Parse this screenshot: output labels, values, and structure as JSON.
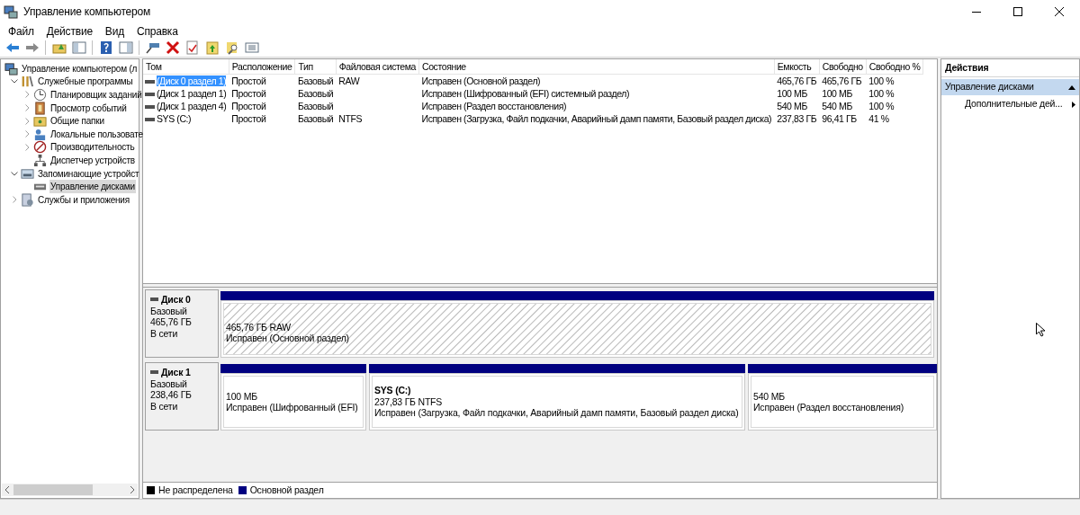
{
  "window": {
    "title": "Управление компьютером"
  },
  "menu": [
    "Файл",
    "Действие",
    "Вид",
    "Справка"
  ],
  "tree": [
    {
      "label": "Управление компьютером (л",
      "selected": false,
      "children": [
        {
          "label": "Служебные программы",
          "selected": false,
          "expanded": true,
          "children": [
            {
              "label": "Планировщик заданий",
              "selected": false,
              "expanded": false
            },
            {
              "label": "Просмотр событий",
              "selected": false,
              "expanded": false
            },
            {
              "label": "Общие папки",
              "selected": false,
              "expanded": false
            },
            {
              "label": "Локальные пользовате",
              "selected": false,
              "expanded": false
            },
            {
              "label": "Производительность",
              "selected": false,
              "expanded": false
            },
            {
              "label": "Диспетчер устройств",
              "selected": false
            }
          ]
        },
        {
          "label": "Запоминающие устройст",
          "selected": false,
          "expanded": true,
          "children": [
            {
              "label": "Управление дисками",
              "selected": true
            }
          ]
        },
        {
          "label": "Службы и приложения",
          "selected": false,
          "expanded": false
        }
      ]
    }
  ],
  "table": {
    "columns": [
      "Том",
      "Расположение",
      "Тип",
      "Файловая система",
      "Состояние",
      "Емкость",
      "Свободно",
      "Свободно %"
    ],
    "rows": [
      {
        "selected": true,
        "cells": [
          "(Диск 0 раздел 1)",
          "Простой",
          "Базовый",
          "RAW",
          "Исправен (Основной раздел)",
          "465,76 ГБ",
          "465,76 ГБ",
          "100 %"
        ]
      },
      {
        "selected": false,
        "cells": [
          "(Диск 1 раздел 1)",
          "Простой",
          "Базовый",
          "",
          "Исправен (Шифрованный (EFI) системный раздел)",
          "100 МБ",
          "100 МБ",
          "100 %"
        ]
      },
      {
        "selected": false,
        "cells": [
          "(Диск 1 раздел 4)",
          "Простой",
          "Базовый",
          "",
          "Исправен (Раздел восстановления)",
          "540 МБ",
          "540 МБ",
          "100 %"
        ]
      },
      {
        "selected": false,
        "cells": [
          "SYS (C:)",
          "Простой",
          "Базовый",
          "NTFS",
          "Исправен (Загрузка, Файл подкачки, Аварийный дамп памяти, Базовый раздел диска)",
          "237,83 ГБ",
          "96,41 ГБ",
          "41 %"
        ]
      }
    ]
  },
  "disks": [
    {
      "name": "Диск 0",
      "type": "Базовый",
      "size": "465,76 ГБ",
      "state": "В сети",
      "partitions": [
        {
          "kind": "primary",
          "selected": true,
          "size_fs": "465,76 ГБ RAW",
          "status": "Исправен (Основной раздел)"
        }
      ]
    },
    {
      "name": "Диск 1",
      "type": "Базовый",
      "size": "238,46 ГБ",
      "state": "В сети",
      "partitions": [
        {
          "kind": "primary",
          "selected": false,
          "size_fs": "100 МБ",
          "status": "Исправен (Шифрованный (EFI)"
        },
        {
          "kind": "primary",
          "selected": false,
          "label": "SYS  (C:)",
          "size_fs": "237,83 ГБ NTFS",
          "status": "Исправен (Загрузка, Файл подкачки, Аварийный дамп памяти, Базовый раздел диска)"
        },
        {
          "kind": "primary",
          "selected": false,
          "size_fs": "540 МБ",
          "status": "Исправен (Раздел восстановления)"
        }
      ]
    }
  ],
  "legend": [
    {
      "label": "Не распределена",
      "color": "#000000"
    },
    {
      "label": "Основной раздел",
      "color": "#000080"
    }
  ],
  "actions": {
    "title": "Действия",
    "groups": [
      {
        "label": "Управление дисками",
        "expanded": true,
        "items": [
          "Дополнительные дей..."
        ]
      }
    ]
  }
}
